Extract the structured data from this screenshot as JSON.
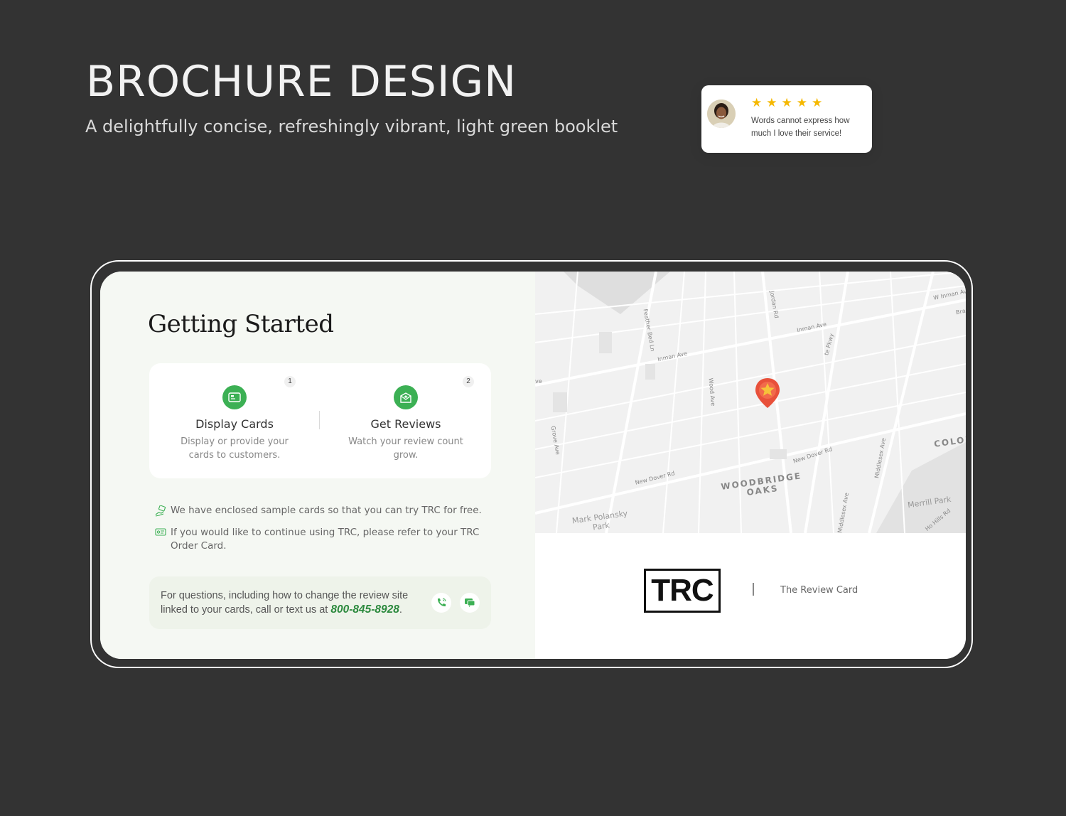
{
  "header": {
    "title": "BROCHURE DESIGN",
    "subtitle": "A delightfully concise, refreshingly vibrant, light green booklet"
  },
  "brochure": {
    "heading": "Getting Started",
    "steps": [
      {
        "number": "1",
        "title": "Display Cards",
        "description": "Display or provide your cards to customers.",
        "icon": "card-icon"
      },
      {
        "number": "2",
        "title": "Get Reviews",
        "description": "Watch your review count grow.",
        "icon": "envelope-star-icon"
      }
    ],
    "notes": [
      {
        "icon": "hand-card-icon",
        "text": "We have enclosed sample cards so that you can try TRC for free."
      },
      {
        "icon": "order-card-icon",
        "text": "If you would like to continue using TRC, please refer to your TRC Order Card."
      }
    ],
    "contact": {
      "text": "For questions, including how to change the review site linked to your cards, call or text us at",
      "phone": "800-845-8928",
      "suffix": "."
    },
    "map": {
      "streets": [
        "W Inman Av",
        "Bra",
        "Jordan Rd",
        "Inman Ave",
        "Inman Ave",
        "Feather Bed Ln",
        "te Pkwy",
        "Wood Ave",
        "Grove Ave",
        "ve",
        "New Dover Rd",
        "New Dover Rd",
        "Middlesex Ave",
        "Middlesex Ave",
        "Ho Hills Rd",
        "Colo"
      ],
      "district": "WOODBRIDGE OAKS",
      "district_line1": "WOODBRIDGE",
      "district_line2": "OAKS",
      "parks": [
        "Mark Polansky Park",
        "Merrill Park"
      ],
      "colon": "COLON",
      "pin_color": "#e8503a"
    },
    "review": {
      "stars": 5,
      "star_glyph": "★",
      "text": "Words cannot express how much I love their service!"
    },
    "brand": {
      "logo": "TRC",
      "name": "The Review Card"
    },
    "colors": {
      "accent": "#3cb054",
      "phone": "#2c8a3e",
      "star": "#f5b800",
      "background": "#333333"
    }
  }
}
